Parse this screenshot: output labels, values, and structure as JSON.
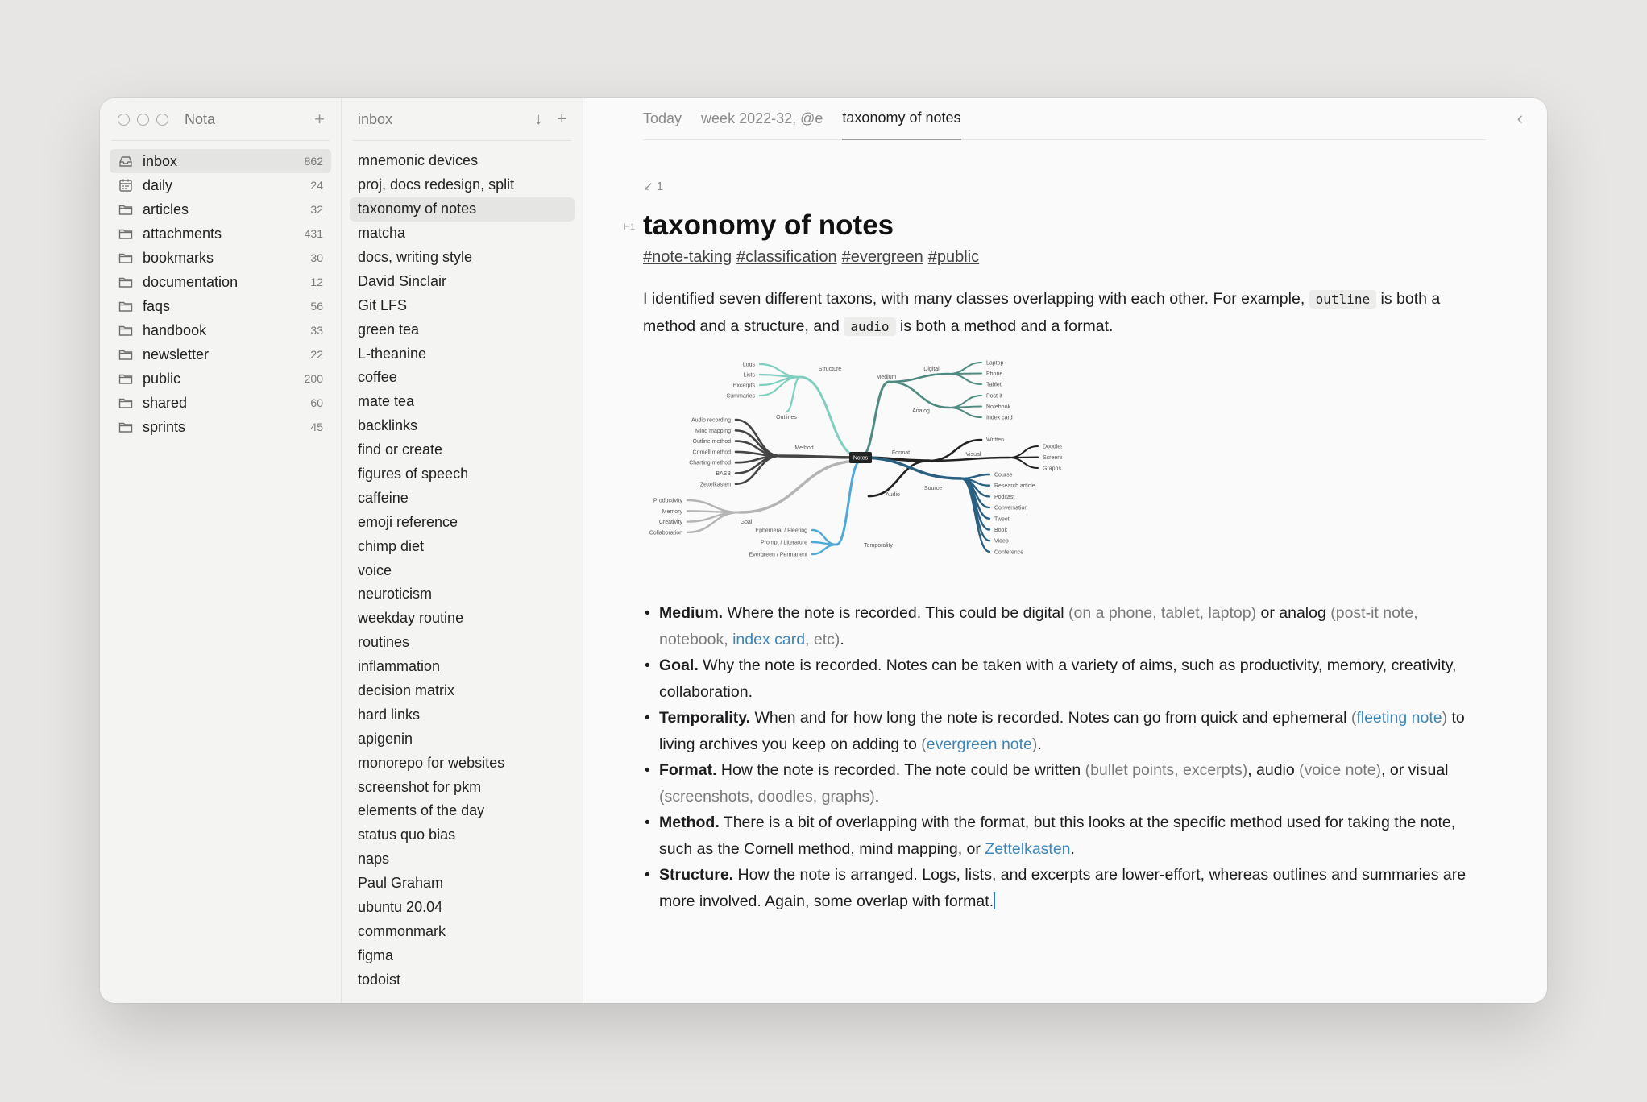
{
  "app": {
    "title": "Nota"
  },
  "sidebar": {
    "items": [
      {
        "label": "inbox",
        "count": "862",
        "icon": "inbox-icon"
      },
      {
        "label": "daily",
        "count": "24",
        "icon": "calendar-icon"
      },
      {
        "label": "articles",
        "count": "32",
        "icon": "folder-icon"
      },
      {
        "label": "attachments",
        "count": "431",
        "icon": "folder-icon"
      },
      {
        "label": "bookmarks",
        "count": "30",
        "icon": "folder-icon"
      },
      {
        "label": "documentation",
        "count": "12",
        "icon": "folder-icon"
      },
      {
        "label": "faqs",
        "count": "56",
        "icon": "folder-icon"
      },
      {
        "label": "handbook",
        "count": "33",
        "icon": "folder-icon"
      },
      {
        "label": "newsletter",
        "count": "22",
        "icon": "folder-icon"
      },
      {
        "label": "public",
        "count": "200",
        "icon": "folder-icon"
      },
      {
        "label": "shared",
        "count": "60",
        "icon": "folder-icon"
      },
      {
        "label": "sprints",
        "count": "45",
        "icon": "folder-icon"
      }
    ]
  },
  "notelist": {
    "title": "inbox",
    "notes": [
      "mnemonic devices",
      "proj, docs redesign, split",
      "taxonomy of notes",
      "matcha",
      "docs, writing style",
      "David Sinclair",
      "Git LFS",
      "green tea",
      "L-theanine",
      "coffee",
      "mate tea",
      "backlinks",
      "find or create",
      "figures of speech",
      "caffeine",
      "emoji reference",
      "chimp diet",
      "voice",
      "neuroticism",
      "weekday routine",
      "routines",
      "inflammation",
      "decision matrix",
      "hard links",
      "apigenin",
      "monorepo for websites",
      "screenshot for pkm",
      "elements of the day",
      "status quo bias",
      "naps",
      "Paul Graham",
      "ubuntu 20.04",
      "commonmark",
      "figma",
      "todoist"
    ],
    "active_index": 2
  },
  "editor": {
    "tabs": [
      "Today",
      "week 2022-32, @e",
      "taxonomy of notes"
    ],
    "active_tab": 2,
    "backlinks": "↙ 1",
    "heading_marker": "H1",
    "title": "taxonomy of notes",
    "tags": [
      "#note-taking",
      "#classification",
      "#evergreen",
      "#public"
    ],
    "intro": {
      "t1": "I identified seven different taxons, with many classes overlapping with each other. For example, ",
      "code1": "outline",
      "t2": " is both a method and a structure, and ",
      "code2": "audio",
      "t3": " is both a method and a format."
    },
    "bullets": [
      {
        "term": "Medium.",
        "parts": [
          {
            "t": " Where the note is recorded. This could be digital "
          },
          {
            "t": "(on a phone, tablet, laptop)",
            "s": "muted"
          },
          {
            "t": " or analog "
          },
          {
            "t": "(post-it note, notebook, ",
            "s": "muted"
          },
          {
            "t": "index card",
            "s": "link"
          },
          {
            "t": ", etc)",
            "s": "muted"
          },
          {
            "t": "."
          }
        ]
      },
      {
        "term": "Goal.",
        "parts": [
          {
            "t": " Why the note is recorded. Notes can be taken with a variety of aims, such as productivity, memory, creativity, collaboration."
          }
        ]
      },
      {
        "term": "Temporality.",
        "parts": [
          {
            "t": " When and for how long the note is recorded. Notes can go from quick and ephemeral "
          },
          {
            "t": "(",
            "s": "muted"
          },
          {
            "t": "fleeting note",
            "s": "link"
          },
          {
            "t": ")",
            "s": "muted"
          },
          {
            "t": " to living archives you keep on adding to "
          },
          {
            "t": "(",
            "s": "muted"
          },
          {
            "t": "evergreen note",
            "s": "link"
          },
          {
            "t": ")",
            "s": "muted"
          },
          {
            "t": "."
          }
        ]
      },
      {
        "term": "Format.",
        "parts": [
          {
            "t": " How the note is recorded. The note could be written "
          },
          {
            "t": "(bullet points, excerpts)",
            "s": "muted"
          },
          {
            "t": ", audio "
          },
          {
            "t": "(voice note)",
            "s": "muted"
          },
          {
            "t": ", or visual "
          },
          {
            "t": "(screenshots, doodles, graphs)",
            "s": "muted"
          },
          {
            "t": "."
          }
        ]
      },
      {
        "term": "Method.",
        "parts": [
          {
            "t": " There is a bit of overlapping with the format, but this looks at the specific method used for taking the note, such as the Cornell method, mind mapping, or "
          },
          {
            "t": "Zettelkasten",
            "s": "link"
          },
          {
            "t": "."
          }
        ]
      },
      {
        "term": "Structure.",
        "parts": [
          {
            "t": " How the note is arranged. Logs, lists, and excerpts are lower-effort, whereas outlines and summaries are more involved. Again, some overlap with format."
          }
        ]
      }
    ],
    "diagram": {
      "center": "Notes",
      "colors": {
        "structure": "#7fcfc0",
        "method": "#444444",
        "goal": "#b4b4b4",
        "temporality": "#4ea8d8",
        "medium": "#4f8a80",
        "format": "#222222",
        "source": "#2b5f80"
      },
      "structure": {
        "label": "Structure",
        "leaves": [
          "Logs",
          "Lists",
          "Excerpts",
          "Summaries",
          "Outlines"
        ]
      },
      "method": {
        "label": "Method",
        "leaves": [
          "Audio recording",
          "Mind mapping",
          "Outline method",
          "Cornell method",
          "Charting method",
          "BASB",
          "Zettelkasten"
        ]
      },
      "goal": {
        "label": "Goal",
        "leaves": [
          "Productivity",
          "Memory",
          "Creativity",
          "Collaboration"
        ]
      },
      "temporality": {
        "label": "Temporality",
        "leaves": [
          "Ephemeral / Fleeting",
          "Prompt / Literature",
          "Evergreen / Permanent"
        ]
      },
      "medium": {
        "label": "Medium",
        "digital": "Digital",
        "analog": "Analog",
        "digital_leaves": [
          "Laptop",
          "Phone",
          "Tablet"
        ],
        "analog_leaves": [
          "Post-it",
          "Notebook",
          "Index card"
        ]
      },
      "format": {
        "label": "Format",
        "written": "Written",
        "visual": "Visual",
        "audio": "Audio",
        "visual_leaves": [
          "Doodles",
          "Screenshots",
          "Graphs"
        ]
      },
      "source": {
        "label": "Source",
        "leaves": [
          "Course",
          "Research article",
          "Podcast",
          "Conversation",
          "Tweet",
          "Book",
          "Video",
          "Conference"
        ]
      }
    }
  }
}
